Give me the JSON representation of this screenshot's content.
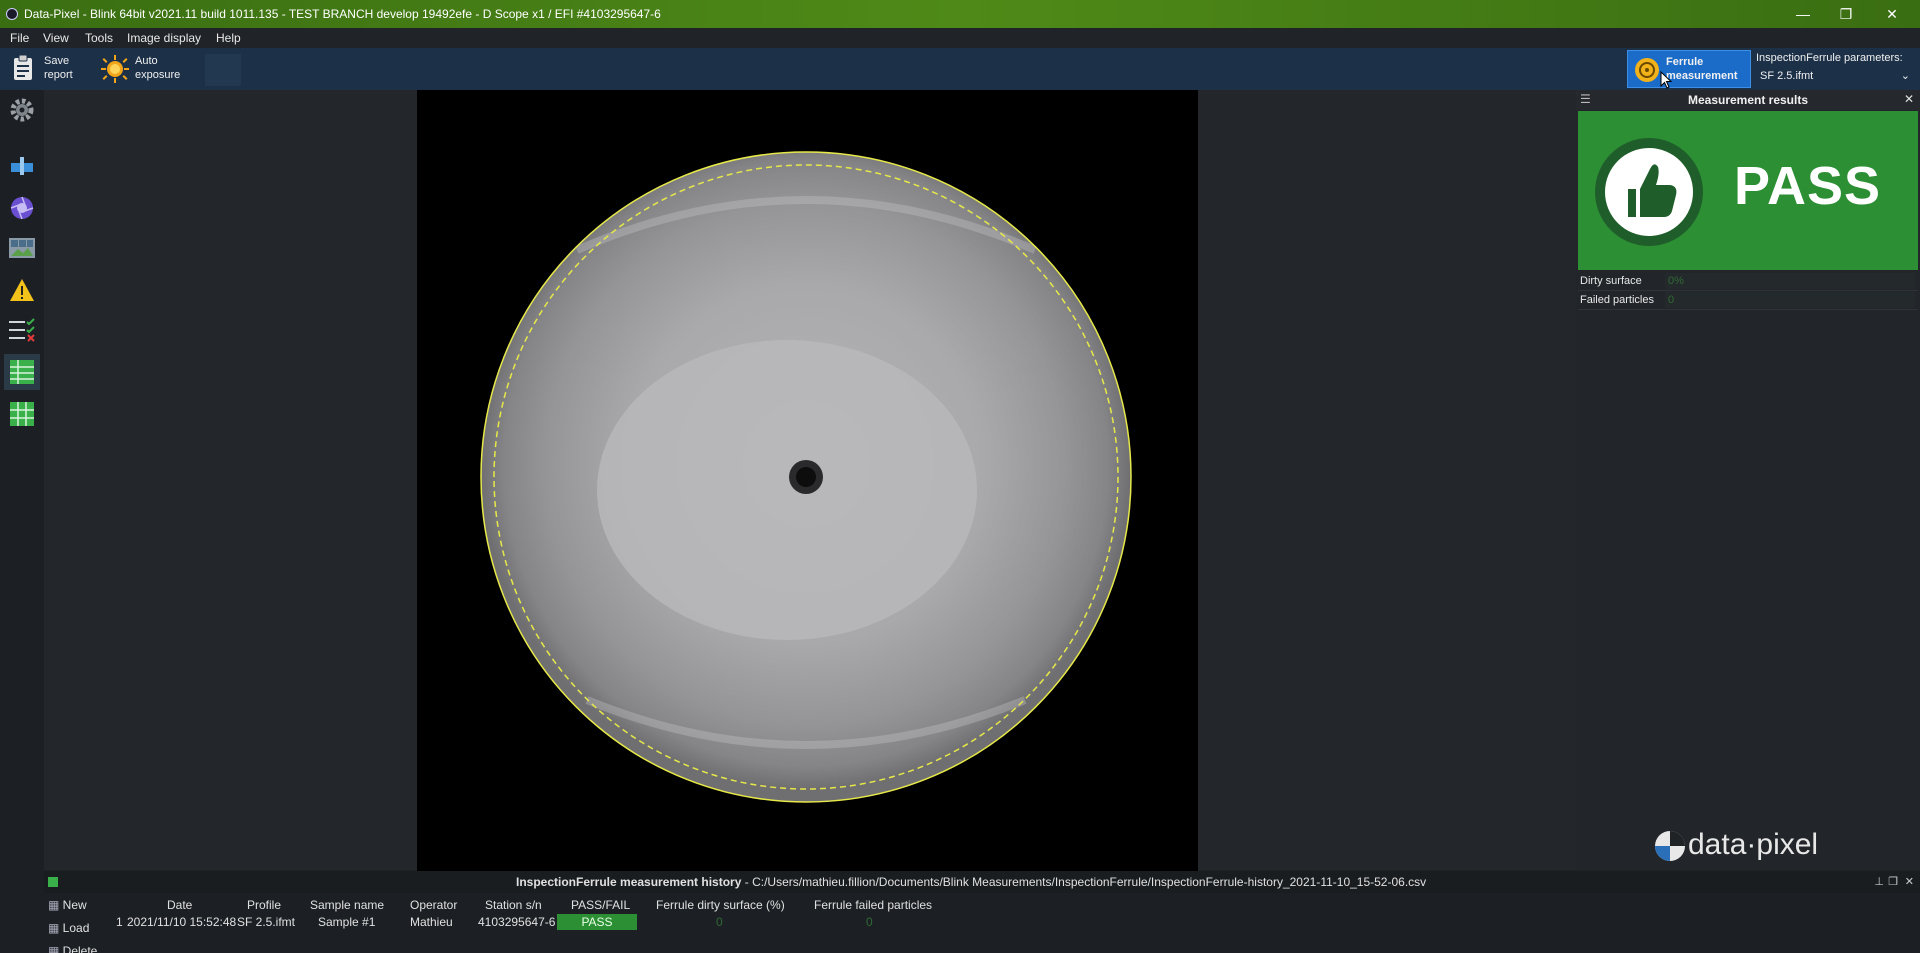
{
  "window": {
    "title": "Data-Pixel - Blink 64bit v2021.11 build 1011.135 - TEST BRANCH develop 19492efe - D Scope x1 / EFI #4103295647-6",
    "minimize": "—",
    "restore": "❐",
    "close": "✕"
  },
  "menu": {
    "items": [
      "File",
      "View",
      "Tools",
      "Image display",
      "Help"
    ]
  },
  "toolbar": {
    "save_line1": "Save",
    "save_line2": "report",
    "auto_line1": "Auto",
    "auto_line2": "exposure",
    "ferrule_line1": "Ferrule",
    "ferrule_line2": "measurement",
    "params_label": "InspectionFerrule parameters:",
    "params_value": "SF 2.5.ifmt"
  },
  "sidebar": {
    "icons": [
      "settings-gear-icon",
      "microscope-icon",
      "aperture-icon",
      "image-strip-icon",
      "warning-icon",
      "checklist-icon",
      "table-icon",
      "table-report-icon"
    ]
  },
  "results": {
    "header": "Measurement results",
    "status": "PASS",
    "rows": [
      {
        "label": "Dirty surface",
        "value": "0%"
      },
      {
        "label": "Failed particles",
        "value": "0"
      }
    ],
    "logo_text": "data·pixel"
  },
  "history": {
    "title": "InspectionFerrule measurement history",
    "path": " - C:/Users/mathieu.fillion/Documents/Blink Measurements/InspectionFerrule/InspectionFerrule-history_2021-11-10_15-52-06.csv",
    "buttons": [
      "New",
      "Load",
      "Delete"
    ],
    "columns": [
      "Date",
      "Profile",
      "Sample name",
      "Operator",
      "Station s/n",
      "PASS/FAIL",
      "Ferrule dirty surface (%)",
      "Ferrule failed particles"
    ],
    "rows": [
      {
        "index": "1",
        "date": "2021/11/10 15:52:48",
        "profile": "SF 2.5.ifmt",
        "sample": "Sample #1",
        "operator": "Mathieu",
        "station": "4103295647-6",
        "result": "PASS",
        "dirty": "0",
        "particles": "0"
      }
    ]
  },
  "colors": {
    "pass_green": "#2d8f34",
    "accent_blue": "#1a6cc8",
    "title_green": "#4f8a18"
  }
}
